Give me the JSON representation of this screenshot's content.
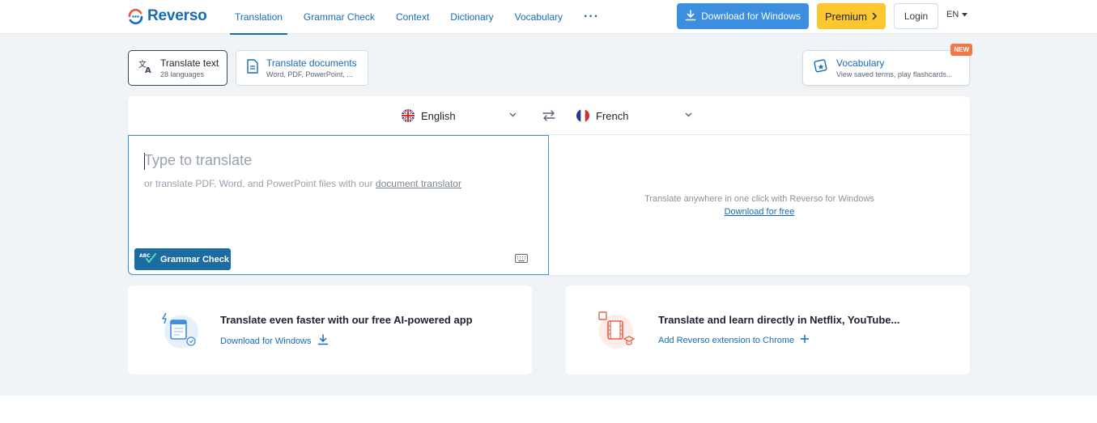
{
  "brand": {
    "name": "Reverso",
    "color": "#166cb8"
  },
  "nav": {
    "items": [
      {
        "label": "Translation",
        "active": true
      },
      {
        "label": "Grammar Check"
      },
      {
        "label": "Context"
      },
      {
        "label": "Dictionary"
      },
      {
        "label": "Vocabulary"
      }
    ],
    "more": "···"
  },
  "header_actions": {
    "download_label": "Download for Windows",
    "premium_label": "Premium",
    "login_label": "Login",
    "ui_language": "EN"
  },
  "modes": {
    "text": {
      "title": "Translate text",
      "subtitle": "28 languages"
    },
    "documents": {
      "title": "Translate documents",
      "subtitle": "Word, PDF, PowerPoint, ..."
    },
    "vocabulary": {
      "title": "Vocabulary",
      "subtitle": "View saved terms, play flashcards...",
      "badge": "NEW"
    }
  },
  "translator": {
    "source_language": "English",
    "target_language": "French",
    "placeholder": "Type to translate",
    "hint_prefix": "or translate PDF, Word, and PowerPoint files with our",
    "hint_link": "document translator",
    "grammar_check_label": "Grammar Check",
    "grammar_badge": "ABC",
    "target_promo": "Translate anywhere in one click with Reverso for Windows",
    "target_promo_link": "Download for free"
  },
  "promos": {
    "app": {
      "title": "Translate even faster with our free AI-powered app",
      "link": "Download for Windows"
    },
    "extension": {
      "title": "Translate and learn directly in Netflix, YouTube...",
      "link": "Add Reverso extension to Chrome"
    }
  },
  "colors": {
    "accent": "#3b8ee0",
    "premium": "#fcc72f",
    "badge_new": "#f2784b",
    "grammar_btn": "#1c6ca1"
  }
}
